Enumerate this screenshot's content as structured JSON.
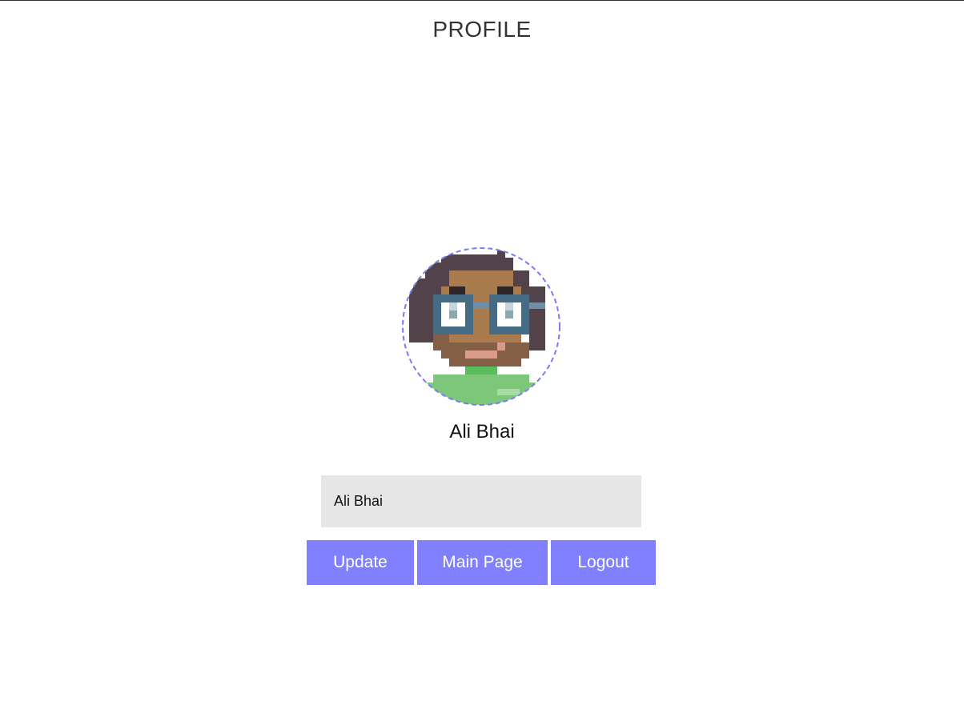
{
  "header": {
    "title": "PROFILE"
  },
  "profile": {
    "avatar_icon": "pixel-avatar-icon",
    "display_name": "Ali Bhai",
    "name_input_value": "Ali Bhai"
  },
  "actions": {
    "update_label": "Update",
    "main_page_label": "Main Page",
    "logout_label": "Logout"
  },
  "colors": {
    "accent": "#8080ff",
    "input_background": "#e6e6e6",
    "avatar_border": "#7b7bef"
  }
}
